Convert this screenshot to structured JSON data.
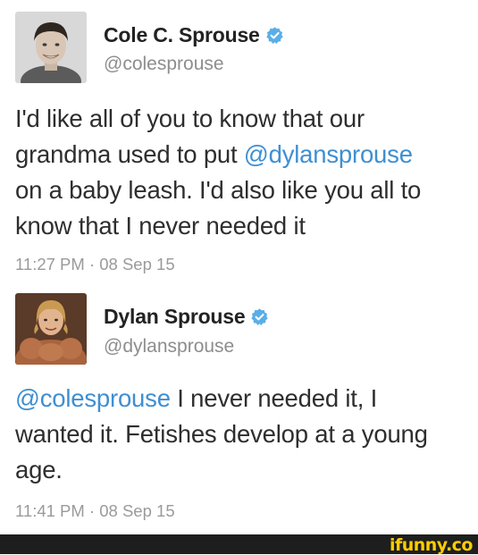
{
  "tweets": [
    {
      "author": "Cole C. Sprouse",
      "handle": "@colesprouse",
      "verified": true,
      "text_lines": [
        [
          {
            "t": "I'd like all of you to know that our"
          }
        ],
        [
          {
            "t": "grandma used to put "
          },
          {
            "t": "@dylansprouse",
            "mention": true
          }
        ],
        [
          {
            "t": "on a baby leash. I'd also like you all to"
          }
        ],
        [
          {
            "t": "know that I never needed it"
          }
        ]
      ],
      "timestamp": "11:27 PM · 08 Sep 15"
    },
    {
      "author": "Dylan Sprouse",
      "handle": "@dylansprouse",
      "verified": true,
      "text_lines": [
        [
          {
            "t": "@colesprouse",
            "mention": true
          },
          {
            "t": " I never needed it, I"
          }
        ],
        [
          {
            "t": "wanted it. Fetishes develop at a young"
          }
        ],
        [
          {
            "t": "age."
          }
        ]
      ],
      "timestamp": "11:41 PM · 08 Sep 15"
    }
  ],
  "watermark": "ifunny.co",
  "colors": {
    "mention": "#3f8fd2",
    "verified": "#5aaee8",
    "watermark": "#ffcc00",
    "footer": "#1e1e1e"
  }
}
